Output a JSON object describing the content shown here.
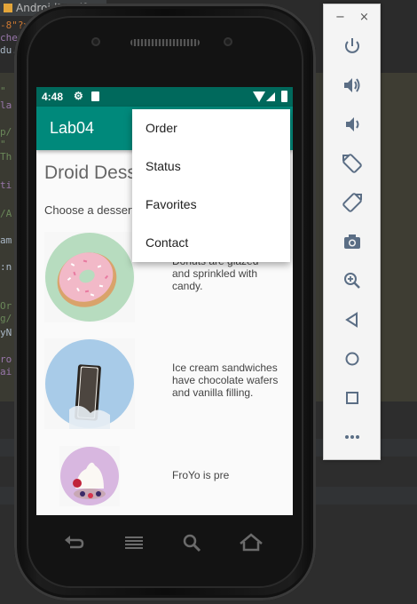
{
  "ide": {
    "tab_label": "AndroidManife",
    "code_lines": [
      {
        "text": "-8\"?>",
        "color": "#cc7832"
      },
      {
        "text": "chem",
        "color": "#9876aa"
      },
      {
        "text": "du.",
        "color": "#a9b7c6"
      },
      {
        "text": "\"",
        "color": "#6a8759"
      },
      {
        "text": "la",
        "color": "#9876aa"
      },
      {
        "text": "p/",
        "color": "#6a8759"
      },
      {
        "text": "\"",
        "color": "#6a8759"
      },
      {
        "text": "Th",
        "color": "#6a8759"
      },
      {
        "text": "ti",
        "color": "#9876aa"
      },
      {
        "text": "/A",
        "color": "#6a8759"
      },
      {
        "text": "am",
        "color": "#a9b7c6"
      },
      {
        "text": ":n",
        "color": "#a9b7c6"
      },
      {
        "text": "Or",
        "color": "#6a8759"
      },
      {
        "text": "g/",
        "color": "#6a8759"
      },
      {
        "text": "yN",
        "color": "#a9b7c6"
      },
      {
        "text": "ro",
        "color": "#9876aa"
      },
      {
        "text": "ai",
        "color": "#9876aa"
      }
    ]
  },
  "status_bar": {
    "time": "4:48"
  },
  "app_bar": {
    "title": "Lab04"
  },
  "main": {
    "title": "Droid Dess",
    "subtitle": "Choose a dessert",
    "items": [
      {
        "name": "donut",
        "description": "Donuts are glazed and sprinkled with candy."
      },
      {
        "name": "ice-cream-sandwich",
        "description": "Ice cream sandwiches have chocolate wafers and vanilla filling."
      },
      {
        "name": "froyo",
        "description": "FroYo is pre"
      }
    ]
  },
  "overflow_menu": {
    "items": [
      "Order",
      "Status",
      "Favorites",
      "Contact"
    ]
  },
  "fab": {
    "icon": "email-icon",
    "color": "#e91e63"
  },
  "colors": {
    "primary": "#00897b",
    "primary_dark": "#00695c",
    "accent": "#e91e63"
  },
  "emulator_toolbar": {
    "minimize": "−",
    "close": "×",
    "buttons": [
      "power-icon",
      "volume-up-icon",
      "volume-down-icon",
      "rotate-left-icon",
      "rotate-right-icon",
      "camera-icon",
      "zoom-icon",
      "back-icon",
      "home-icon",
      "overview-icon",
      "more-icon"
    ]
  }
}
